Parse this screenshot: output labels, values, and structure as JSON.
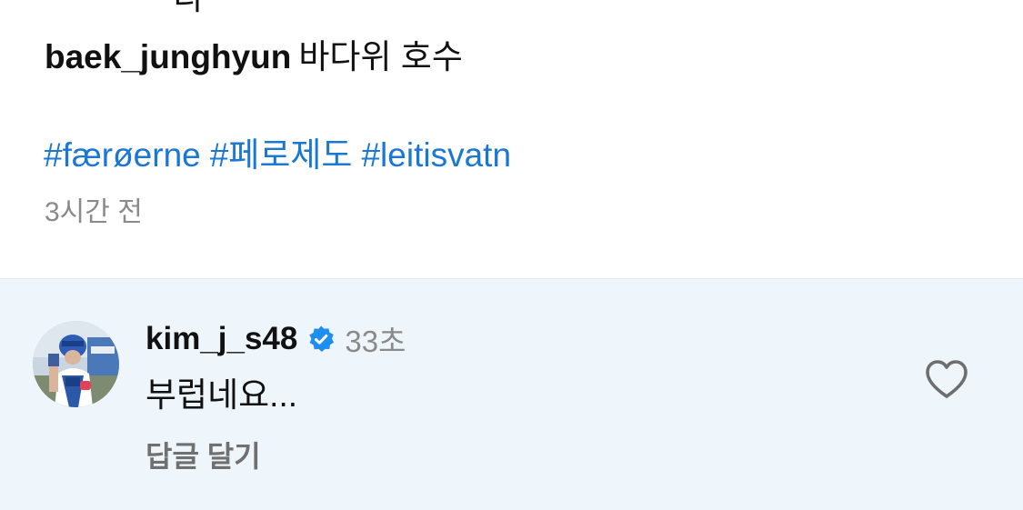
{
  "post": {
    "cut_glyph": "디",
    "username": "baek_junghyun",
    "caption": "바다위 호수",
    "hashtags": [
      "#færøerne",
      "#페로제도",
      "#leitisvatn"
    ],
    "time": "3시간 전"
  },
  "comment": {
    "username": "kim_j_s48",
    "verified": true,
    "age": "33초",
    "text": "부럽네요...",
    "reply_label": "답글 달기",
    "like_icon": "heart-outline-icon",
    "verified_icon": "verified-badge-icon"
  },
  "colors": {
    "hashtag": "#1a78d4",
    "verified": "#1f8ef1",
    "comment_bg": "#eff6fb",
    "muted_text": "#8a8a8a"
  }
}
